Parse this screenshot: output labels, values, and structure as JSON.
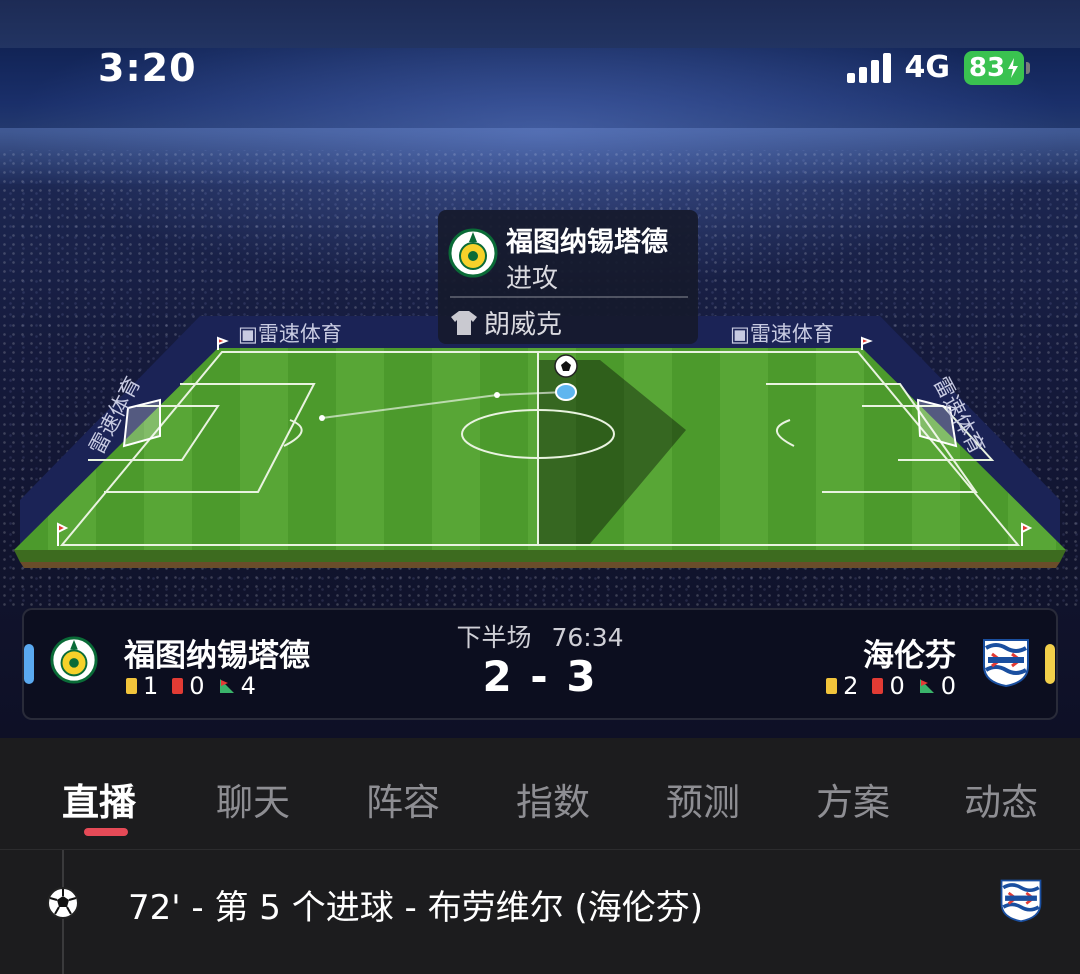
{
  "status_bar": {
    "time": "3:20",
    "network": "4G",
    "battery": "83"
  },
  "event_tooltip": {
    "team": "福图纳锡塔德",
    "action": "进攻",
    "player": "朗威克"
  },
  "pitch": {
    "ad_boards": [
      "雷速体育",
      "雷速体育",
      "雷速体育",
      "雷速体育"
    ]
  },
  "match": {
    "period": "下半场",
    "clock": "76:34",
    "score": "2 - 3",
    "home": {
      "name": "福图纳锡塔德",
      "yellow": "1",
      "red": "0",
      "corners": "4",
      "color": "#5aa9f0"
    },
    "away": {
      "name": "海伦芬",
      "yellow": "2",
      "red": "0",
      "corners": "0",
      "color": "#f2cf4a"
    }
  },
  "tabs": [
    {
      "label": "直播",
      "active": true
    },
    {
      "label": "聊天"
    },
    {
      "label": "阵容"
    },
    {
      "label": "指数"
    },
    {
      "label": "预测"
    },
    {
      "label": "方案"
    },
    {
      "label": "动态"
    }
  ],
  "feed": [
    {
      "icon": "soccer-ball-icon",
      "text": "72' - 第 5 个进球 - 布劳维尔 (海伦芬)"
    }
  ],
  "colors": {
    "accent": "#e54a57",
    "pitch_green": "#4f9a2e",
    "battery_green": "#3ac250"
  }
}
